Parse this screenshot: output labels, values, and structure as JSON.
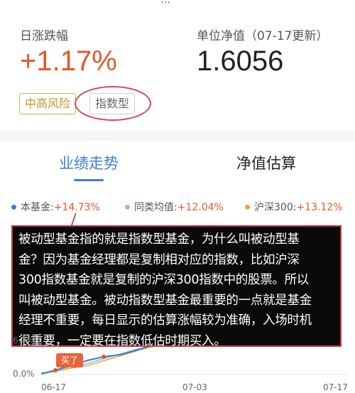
{
  "top_cut_text": "…",
  "stats": {
    "change_label": "日涨跌幅",
    "change_value": "+1.17%",
    "nav_label": "单位净值（07-17更新）",
    "nav_value": "1.6056"
  },
  "tags": {
    "risk": "中高风险",
    "type": "指数型"
  },
  "tabs": {
    "performance": "业绩走势",
    "estimate": "净值估算"
  },
  "legend": {
    "fund_label": "本基金:",
    "fund_value": "+14.73%",
    "peer_label": "同类均值:",
    "peer_value": "+12.04%",
    "csi_label": "沪深300:",
    "csi_value": "+13.12%"
  },
  "annotation": {
    "line1": "被动型基金指的就是指数型基金，为什么叫被动型基",
    "line2": "金？因为基金经理都是复制相对应的指数，比如沪深",
    "line3": "300指数基金就是复制的沪深300指数中的股票。所以",
    "line4": "叫被动型基金。被动指数型基金最重要的一点就是基金",
    "line5": "经理不重要，每日显示的估算涨幅较为准确，入场时机",
    "line6": "很重要，一定要在指数低估时期买入。"
  },
  "chart": {
    "y_tick_6": "6.0%",
    "y_tick_0": "0.0%",
    "x_tick_1": "06-17",
    "x_tick_2": "07-03",
    "x_tick_3": "07-17",
    "buy_badge": "买了"
  },
  "colors": {
    "fund": "#3a7be0",
    "peer": "#86c1ea",
    "csi": "#f0a336",
    "positive": "#e2582a",
    "annotation_border": "#c9303c"
  }
}
